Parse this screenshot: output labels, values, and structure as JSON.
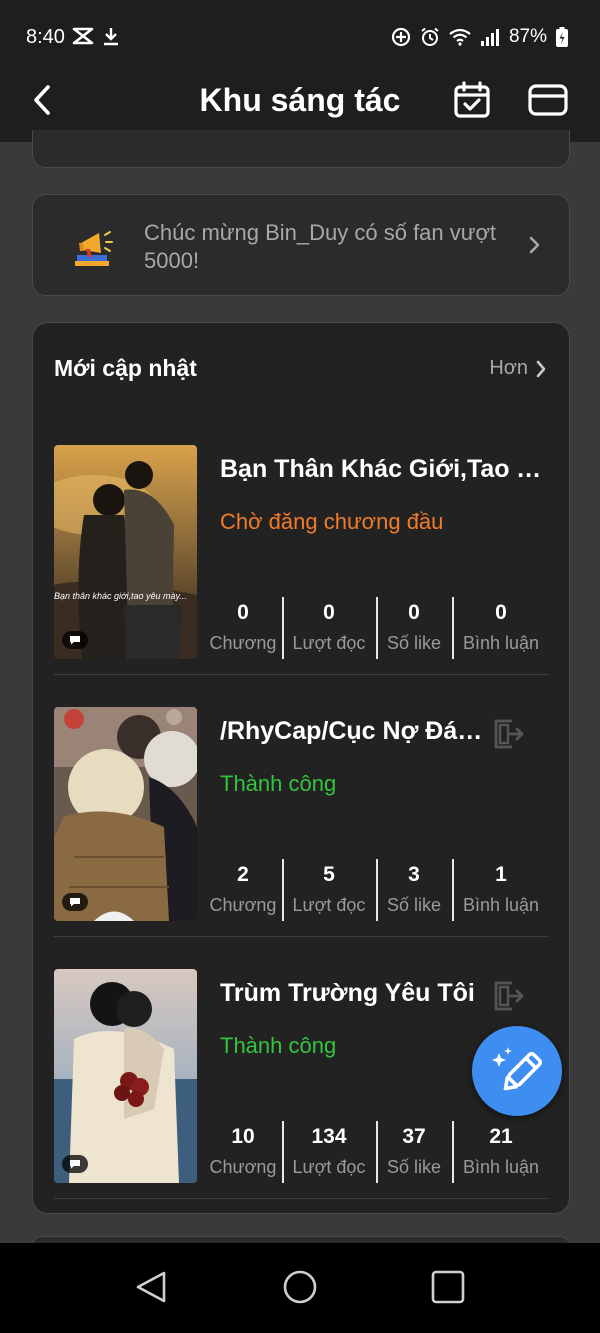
{
  "status_bar": {
    "time": "8:40",
    "battery": "87%"
  },
  "header": {
    "title": "Khu sáng tác"
  },
  "announcement": {
    "text": "Chúc mừng Bin_Duy có số fan vượt 5000!"
  },
  "updates": {
    "title": "Mới cập nhật",
    "more_label": "Hơn",
    "stat_labels": {
      "chapters": "Chương",
      "reads": "Lượt đọc",
      "likes": "Số like",
      "comments": "Bình luận"
    },
    "stories": [
      {
        "title": "Bạn Thân Khác Giới,Tao Y...",
        "status": "Chờ đăng chương đầu",
        "status_color": "#f27b28",
        "cover_caption": "Bạn thân khác giới,tao yêu mày...",
        "chapters": "0",
        "reads": "0",
        "likes": "0",
        "comments": "0"
      },
      {
        "title": "/RhyCap/Cục Nợ Đán...",
        "status": "Thành công",
        "status_color": "#34c43c",
        "chapters": "2",
        "reads": "5",
        "likes": "3",
        "comments": "1"
      },
      {
        "title": "Trùm Trường Yêu Tôi",
        "status": "Thành công",
        "status_color": "#34c43c",
        "chapters": "10",
        "reads": "134",
        "likes": "37",
        "comments": "21"
      }
    ]
  },
  "colors": {
    "background": "#3a3a3a",
    "card": "#222222",
    "fab": "#3d8ef0",
    "pending": "#f27b28",
    "success": "#34c43c"
  }
}
